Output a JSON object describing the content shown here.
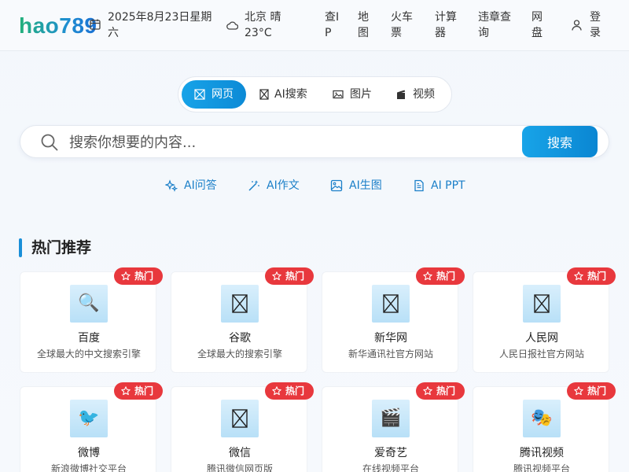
{
  "header": {
    "logo": "hao789",
    "date": "2025年8月23日星期六",
    "weather": "北京  晴 23°C",
    "nav": [
      "查IP",
      "地图",
      "火车票",
      "计算器",
      "违章查询",
      "网盘"
    ],
    "login": "登录"
  },
  "search": {
    "tabs": [
      "网页",
      "AI搜索",
      "图片",
      "视频"
    ],
    "active_tab": "网页",
    "placeholder": "搜索你想要的内容...",
    "button": "搜索"
  },
  "ai_tools": [
    "AI问答",
    "AI作文",
    "AI生图",
    "AI PPT"
  ],
  "section_title": "热门推荐",
  "badge_label": "热门",
  "cards": [
    {
      "name": "百度",
      "desc": "全球最大的中文搜索引擎",
      "icon": "magnifier-icon"
    },
    {
      "name": "谷歌",
      "desc": "全球最大的搜索引擎",
      "icon": "placeholder-icon"
    },
    {
      "name": "新华网",
      "desc": "新华通讯社官方网站",
      "icon": "placeholder-icon"
    },
    {
      "name": "人民网",
      "desc": "人民日报社官方网站",
      "icon": "placeholder-icon"
    },
    {
      "name": "微博",
      "desc": "新浪微博社交平台",
      "icon": "bird-icon"
    },
    {
      "name": "微信",
      "desc": "腾讯微信网页版",
      "icon": "placeholder-icon"
    },
    {
      "name": "爱奇艺",
      "desc": "在线视频平台",
      "icon": "clapper-icon"
    },
    {
      "name": "腾讯视频",
      "desc": "腾讯视频平台",
      "icon": "masks-icon"
    }
  ],
  "colors": {
    "accent": "#1a8fd8",
    "hot": "#e8383d",
    "link": "#1a7fc8"
  }
}
